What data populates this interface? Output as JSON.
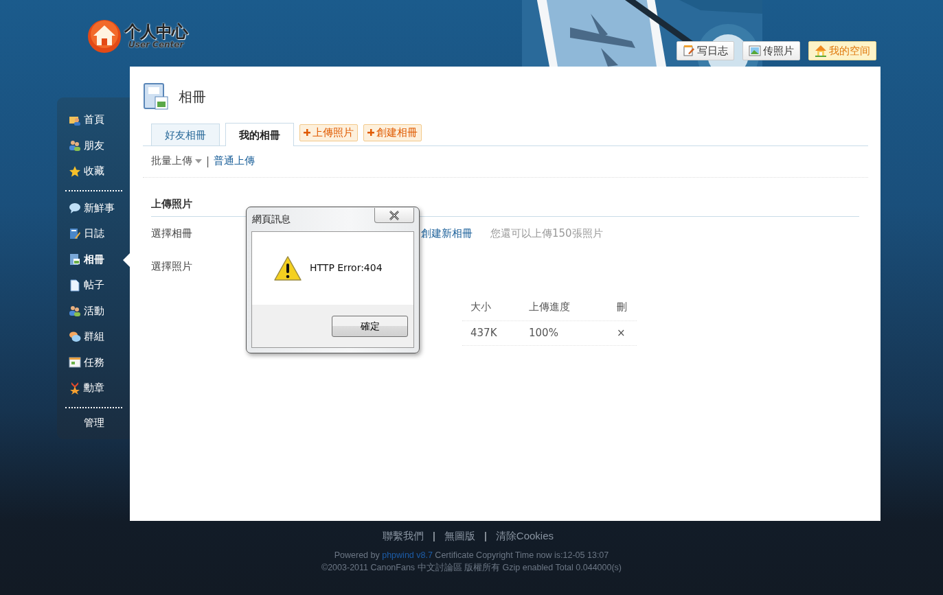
{
  "logo": {
    "title": "个人中心",
    "subtitle": "User Center"
  },
  "header_buttons": [
    {
      "label": "写日志",
      "kind": "write"
    },
    {
      "label": "传照片"
    },
    {
      "label": "我的空间",
      "kind": "home"
    }
  ],
  "sidebar": {
    "groups": [
      {
        "items": [
          {
            "label": "首頁",
            "selected": false
          },
          {
            "label": "朋友",
            "selected": false
          },
          {
            "label": "收藏",
            "selected": false
          }
        ]
      },
      {
        "items": [
          {
            "label": "新鮮事",
            "selected": false
          },
          {
            "label": "日誌",
            "selected": false
          },
          {
            "label": "相冊",
            "selected": true
          },
          {
            "label": "帖子",
            "selected": false
          },
          {
            "label": "活動",
            "selected": false
          },
          {
            "label": "群組",
            "selected": false
          },
          {
            "label": "任務",
            "selected": false
          },
          {
            "label": "勳章",
            "selected": false
          }
        ]
      }
    ],
    "manage": "管理"
  },
  "page": {
    "title": "相冊",
    "tabs": [
      {
        "label": "好友相冊",
        "selected": false
      },
      {
        "label": "我的相冊",
        "selected": true
      }
    ],
    "actions": [
      "上傳照片",
      "創建相冊"
    ],
    "upload_modes": [
      {
        "label": "批量上傳",
        "kind": "dropdown"
      },
      {
        "label": "普通上傳",
        "kind": "link"
      }
    ],
    "mode_separator": "|",
    "section_title": "上傳照片",
    "form": [
      {
        "label": "選擇相冊",
        "link": "創建新相冊",
        "note": "您還可以上傳150張照片"
      },
      {
        "label": "選擇照片"
      }
    ],
    "table": {
      "columns": [
        "大小",
        "上傳進度",
        "刪"
      ],
      "rows": [
        [
          "437K",
          "100%",
          "×"
        ]
      ]
    }
  },
  "dialog": {
    "title": "網頁訊息",
    "message": "HTTP Error:404",
    "button": "確定"
  },
  "footer": {
    "links": [
      "聯繫我們",
      "無圖版",
      "清除Cookies"
    ],
    "separator": "|",
    "powered_prefix": "Powered by",
    "powered_link": "phpwind v8.7",
    "powered_suffix": "Certificate Copyright Time now is:12-05 13:07",
    "copyright": "©2003-2011 CanonFans 中文討論區 版權所有 Gzip enabled  Total 0.044000(s)"
  }
}
